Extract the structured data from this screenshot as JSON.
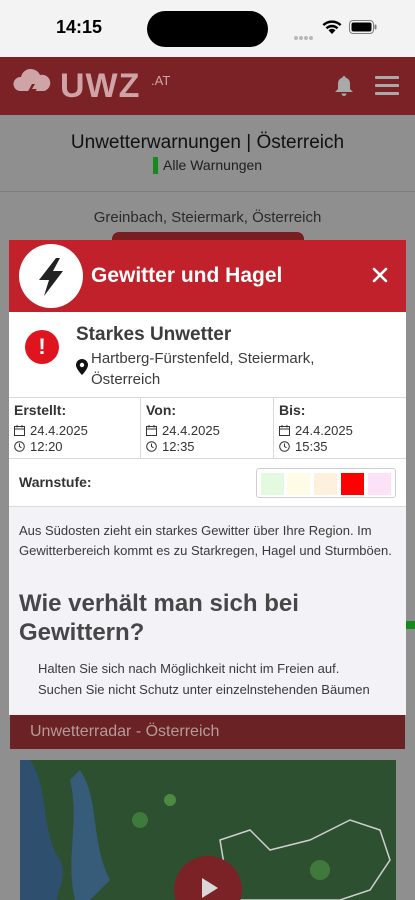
{
  "status_bar": {
    "time": "14:15"
  },
  "app_header": {
    "logo_text": "UWZ",
    "logo_suffix": ".AT"
  },
  "background": {
    "title": "Unwetterwarnungen | Österreich",
    "filter_label": "Alle Warnungen",
    "location": "Greinbach, Steiermark, Österreich",
    "radar_title": "Unwetterradar - Österreich"
  },
  "modal": {
    "title": "Gewitter und Hagel",
    "severity": "Starkes Unwetter",
    "location": "Hartberg-Fürstenfeld, Steiermark, Österreich",
    "times": [
      {
        "label": "Erstellt:",
        "date": "24.4.2025",
        "time": "12:20"
      },
      {
        "label": "Von:",
        "date": "24.4.2025",
        "time": "12:35"
      },
      {
        "label": "Bis:",
        "date": "24.4.2025",
        "time": "15:35"
      }
    ],
    "warnstufe_label": "Warnstufe:",
    "level_colors": [
      "#e4fae0",
      "#fefbe6",
      "#fdf0dc",
      "#ff0000",
      "#fbe2f6"
    ],
    "active_level": 4,
    "description": "Aus Südosten zieht ein starkes Gewitter über Ihre Region. Im Gewitterbereich kommt es zu Starkregen, Hagel und Sturmböen.",
    "advice_title": "Wie verhält man sich bei Gewittern?",
    "advice_text": "Halten Sie sich nach Möglichkeit nicht im Freien auf. Suchen Sie nicht Schutz unter einzelnstehenden Bäumen"
  },
  "colors": {
    "brand_red": "#c0212a",
    "severity_red": "#e0141e"
  }
}
